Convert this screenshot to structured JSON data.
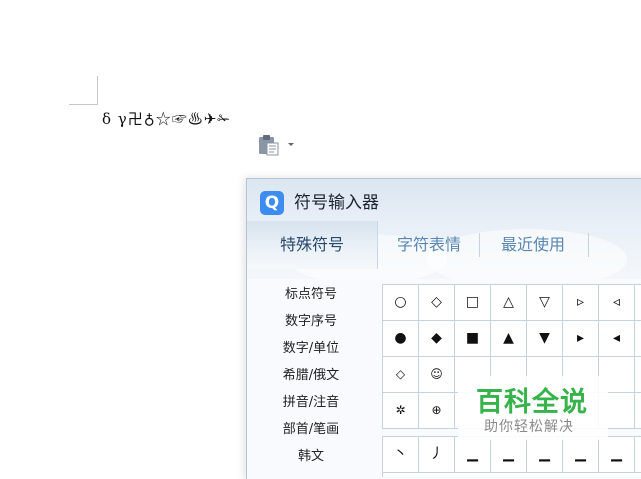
{
  "document": {
    "inserted_symbols": "δ γ卍♁☆☞♨✈✁"
  },
  "paste_options": {
    "icon": "clipboard-icon"
  },
  "symbol_window": {
    "logo_letter": "Q",
    "title": "符号输入器",
    "tabs": [
      {
        "label": "特殊符号",
        "active": true
      },
      {
        "label": "字符表情",
        "active": false
      },
      {
        "label": "最近使用",
        "active": false
      }
    ],
    "categories": [
      "标点符号",
      "数字序号",
      "数字/单位",
      "希腊/俄文",
      "拼音/注音",
      "部首/笔画",
      "韩文"
    ],
    "grid_rows": [
      [
        "○",
        "◇",
        "□",
        "△",
        "▽",
        "▹",
        "◃",
        "☆"
      ],
      [
        "●",
        "◆",
        "■",
        "▲",
        "▼",
        "▸",
        "◂",
        "★"
      ],
      [
        "◇",
        "☺",
        "",
        "",
        "",
        "",
        "",
        "♀"
      ],
      [
        "✲",
        "⊕",
        "",
        "",
        "",
        "",
        "",
        "♂"
      ]
    ],
    "stroke_row": [
      "丶",
      "丿",
      "▁",
      "▁",
      "▁",
      "▁",
      "▁",
      "▁"
    ]
  },
  "watermark": {
    "main": "百科全说",
    "sub": "助你轻松解决",
    "color": "#36b34a"
  }
}
